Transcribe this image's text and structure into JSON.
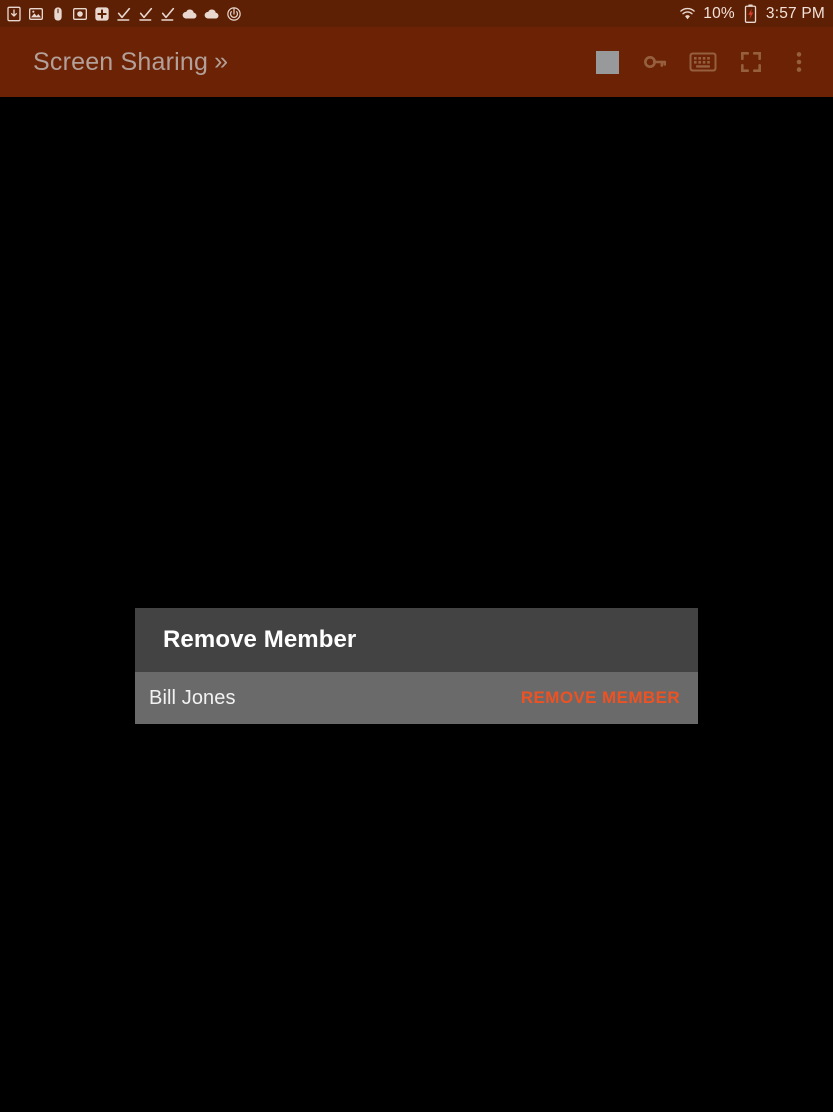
{
  "status_bar": {
    "background_color": "#5e2004",
    "left_icons": [
      {
        "name": "download-icon",
        "glyph": "download"
      },
      {
        "name": "screenshot-icon",
        "glyph": "image"
      },
      {
        "name": "mouse-icon",
        "glyph": "mouse"
      },
      {
        "name": "camera-icon",
        "glyph": "camera"
      },
      {
        "name": "add-circle-icon",
        "glyph": "plus-box"
      },
      {
        "name": "download-complete-icon-1",
        "glyph": "check-download"
      },
      {
        "name": "download-complete-icon-2",
        "glyph": "check-download"
      },
      {
        "name": "download-complete-icon-3",
        "glyph": "check-download"
      },
      {
        "name": "cloud-icon-1",
        "glyph": "cloud"
      },
      {
        "name": "cloud-icon-2",
        "glyph": "cloud"
      },
      {
        "name": "power-icon",
        "glyph": "power-circle"
      }
    ],
    "wifi_icon": "wifi-icon",
    "battery_percent": "10%",
    "battery_icon": "battery-low-icon",
    "clock": "3:57 PM"
  },
  "app_bar": {
    "background_color": "#6b2205",
    "title": "Screen Sharing",
    "title_chevrons": "»",
    "actions": [
      {
        "name": "stop-sharing-button",
        "icon": "stop-square-icon"
      },
      {
        "name": "password-button",
        "icon": "key-icon"
      },
      {
        "name": "keyboard-button",
        "icon": "keyboard-icon"
      },
      {
        "name": "fullscreen-button",
        "icon": "fullscreen-icon"
      },
      {
        "name": "overflow-menu-button",
        "icon": "more-vert-icon"
      }
    ]
  },
  "dialog": {
    "title": "Remove Member",
    "header_color": "#434343",
    "row_color": "#6a6a6a",
    "member_name": "Bill Jones",
    "remove_label": "REMOVE MEMBER",
    "remove_color": "#ef5222"
  }
}
